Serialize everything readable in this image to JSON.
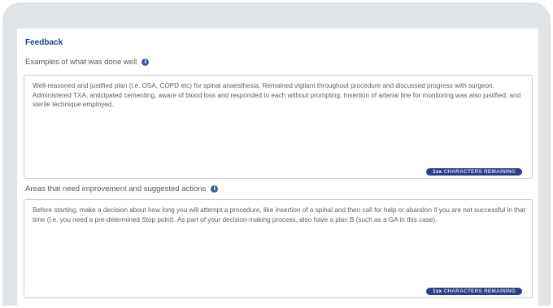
{
  "feedback": {
    "title": "Feedback",
    "well_done": {
      "label": "Examples of what was done well",
      "text": "Well-reasoned and justified plan (i.e. OSA, COPD etc) for spinal anaesthesia.  Remained vigilant throughout procedure and discussed progress with surgeon. Administered TXA, anticipated cementing, aware of blood loss and responded to each without prompting. Insertion of arterial line for monitoring was also justified, and sterile technique employed.",
      "counter_number": "1xx",
      "counter_label": "CHARACTERS REMAINING"
    },
    "improvement": {
      "label": "Areas that need improvement and suggested actions",
      "text": "Before starting, make a decision about how long you will attempt a procedure, like insertion of a spinal and then call for help or abandon if you are not successful in that time (i.e. you need a pre-determined Stop point). As part of your decision-making process, also have a plan B (such as a GA in this case).",
      "counter_number": "1xx",
      "counter_label": "CHARACTERS REMAINING"
    }
  }
}
